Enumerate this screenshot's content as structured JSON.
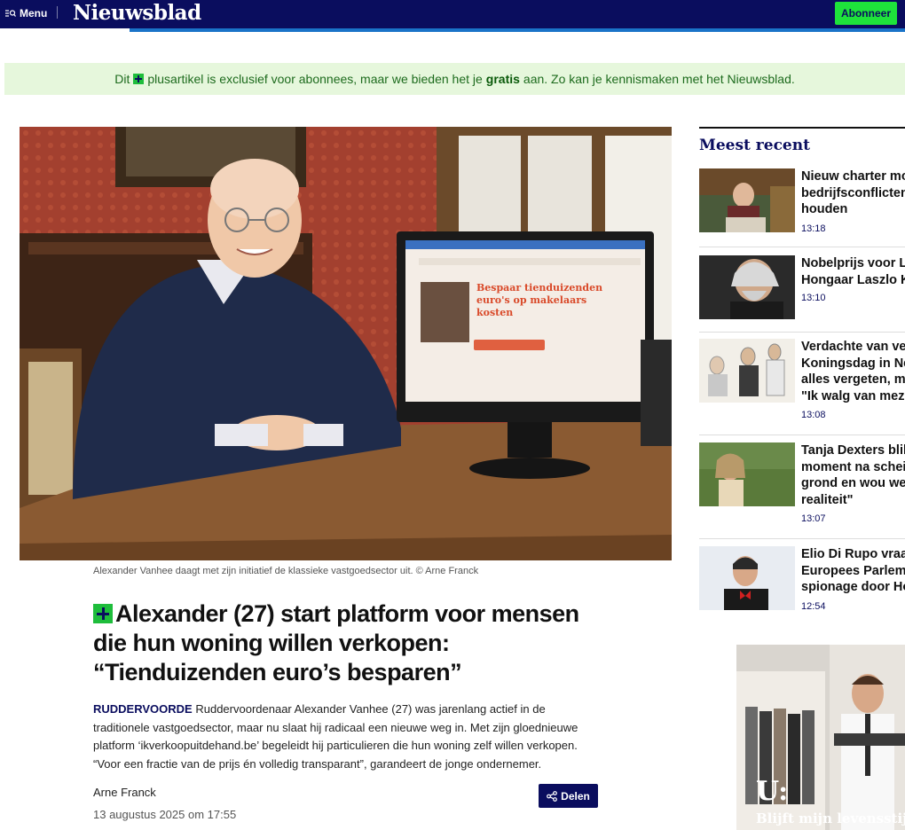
{
  "header": {
    "menu_label": "Menu",
    "logo": "Nieuwsblad",
    "subscribe_label": "Abonneer"
  },
  "promo": {
    "part1": "Dit",
    "part2": "plusartikel is exclusief voor abonnees, maar we bieden het je",
    "bold": "gratis",
    "part3": "aan. Zo kan je kennismaken met het Nieuwsblad."
  },
  "article": {
    "caption": "Alexander Vanhee daagt met zijn initiatief de klassieke vastgoedsector uit. © Arne Franck",
    "headline": "Alexander (27) start platform voor mensen die hun woning willen verkopen: “Tienduizenden euro’s besparen”",
    "location": "RUDDERVOORDE",
    "lead": "Ruddervoordenaar Alexander Vanhee (27) was jarenlang actief in de traditionele vastgoedsector, maar nu slaat hij radicaal een nieuwe weg in. Met zijn gloednieuwe platform ‘ikverkoopuitdehand.be’ begeleidt hij particulieren die hun woning zelf willen verkopen. “Voor een fractie van de prijs én volledig transparant”, garandeert de jonge ondernemer.",
    "author": "Arne Franck",
    "date": "13 augustus 2025 om 17:55",
    "share_label": "Delen",
    "screen_heading": "Bespaar tienduizenden euro's op makelaars kosten"
  },
  "sidebar": {
    "title": "Meest recent",
    "items": [
      {
        "lines": [
          "Nieuw charter moet",
          "bedrijfsconflicten",
          "houden"
        ],
        "time": "13:18"
      },
      {
        "lines": [
          "Nobelprijs voor Literatuur",
          "Hongaar Laszlo Kr"
        ],
        "time": "13:10"
      },
      {
        "lines": [
          "Verdachte van verkrachting",
          "Koningsdag in Nederland",
          "alles vergeten, maar",
          "\"Ik walg van mezelf\""
        ],
        "time": "13:08"
      },
      {
        "lines": [
          "Tanja Dexters blikt",
          "moment na scheiding",
          "grond en wou weg",
          "realiteit\""
        ],
        "time": "13:07"
      },
      {
        "lines": [
          "Elio Di Rupo vraagt",
          "Europees Parlement",
          "spionage door Hongarije"
        ],
        "time": "12:54"
      }
    ]
  },
  "ad": {
    "logo": "U:",
    "text": "Blijft mijn levensstijl"
  },
  "colors": {
    "brand_navy": "#0a0d5e",
    "accent_green": "#1ee33b",
    "promo_bg": "#e6f7dc",
    "link_blue": "#1a73c8"
  }
}
